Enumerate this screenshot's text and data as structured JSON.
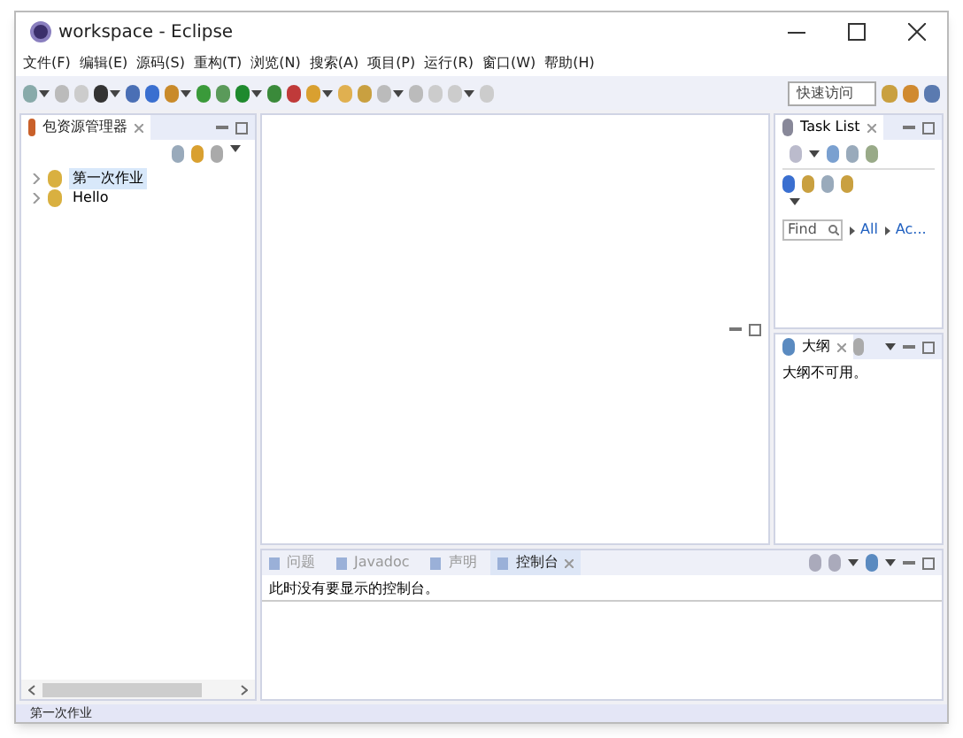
{
  "window": {
    "title": "workspace - Eclipse"
  },
  "menu": [
    "文件(F)",
    "编辑(E)",
    "源码(S)",
    "重构(T)",
    "浏览(N)",
    "搜索(A)",
    "项目(P)",
    "运行(R)",
    "窗口(W)",
    "帮助(H)"
  ],
  "quick_access": {
    "placeholder": "快速访问"
  },
  "package_explorer": {
    "title": "包资源管理器",
    "items": [
      {
        "label": "第一次作业",
        "selected": true,
        "expanded": false
      },
      {
        "label": "Hello",
        "selected": false,
        "expanded": false
      }
    ]
  },
  "task_list": {
    "title": "Task List",
    "find": {
      "placeholder": "Find"
    },
    "links": [
      "All",
      "Ac..."
    ]
  },
  "outline": {
    "title": "大纲",
    "message": "大纲不可用。"
  },
  "bottom_tabs": [
    {
      "label": "问题",
      "selected": false
    },
    {
      "label": "Javadoc",
      "selected": false
    },
    {
      "label": "声明",
      "selected": false
    },
    {
      "label": "控制台",
      "selected": true
    }
  ],
  "console": {
    "message": "此时没有要显示的控制台。"
  },
  "status_bar": {
    "text": "第一次作业"
  }
}
